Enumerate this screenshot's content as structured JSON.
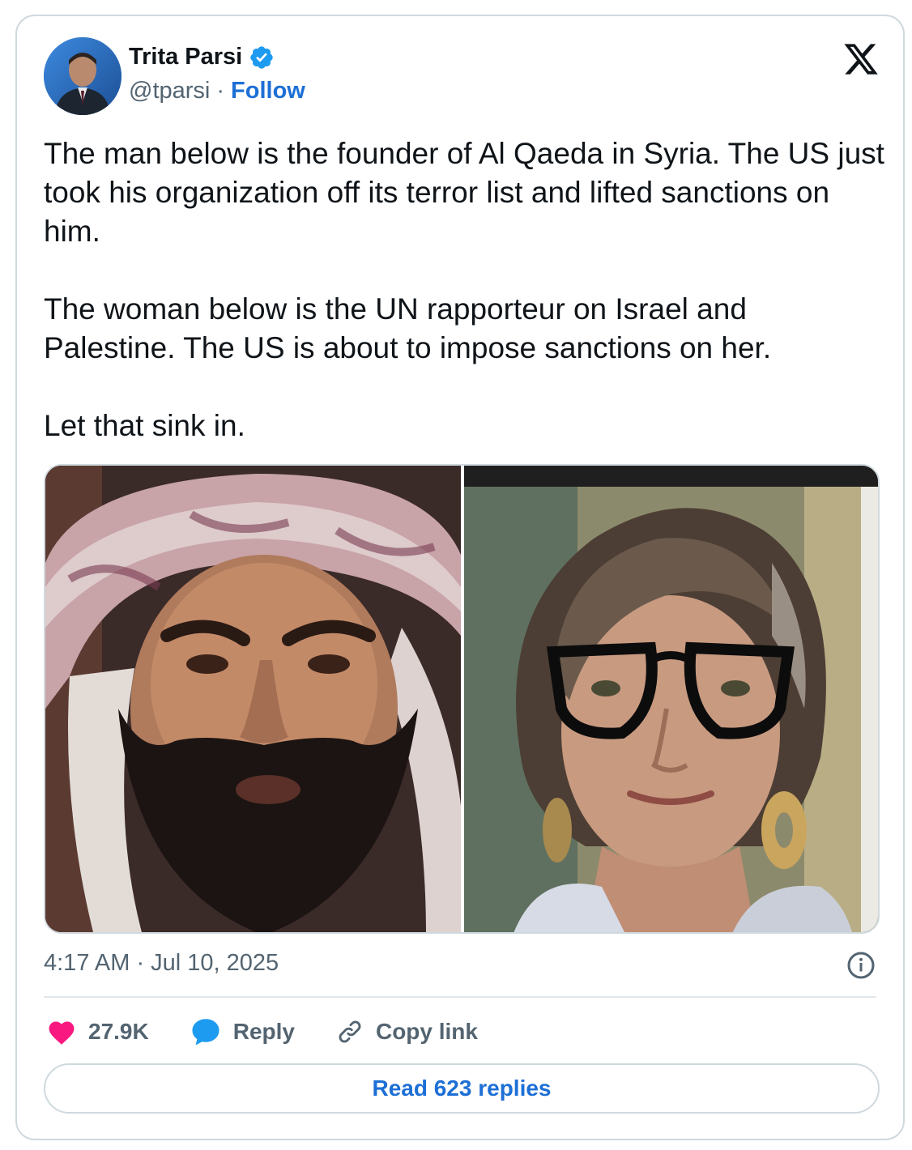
{
  "author": {
    "name": "Trita Parsi",
    "handle": "@tparsi",
    "separator": "·",
    "follow_label": "Follow"
  },
  "tweet": {
    "paragraphs": [
      "The man below is the founder of Al Qaeda in Syria. The US just took his organization off its terror list and lifted sanctions on him.",
      "The woman below is the UN rapporteur on Israel and Palestine. The US is about to impose sanctions on her.",
      "Let that sink in."
    ],
    "timestamp": "4:17 AM · Jul 10, 2025"
  },
  "actions": {
    "likes_count": "27.9K",
    "reply_label": "Reply",
    "copy_link_label": "Copy link",
    "read_replies_label": "Read 623 replies"
  },
  "icons": [
    "verified-badge-icon",
    "x-logo-icon",
    "info-icon",
    "heart-icon",
    "reply-bubble-icon",
    "link-icon"
  ],
  "colors": {
    "accent": "#1d6fd6",
    "verified": "#1d9bf0",
    "heart": "#f91880",
    "text": "#0f1419",
    "muted": "#536471",
    "border": "#cfd9de"
  }
}
